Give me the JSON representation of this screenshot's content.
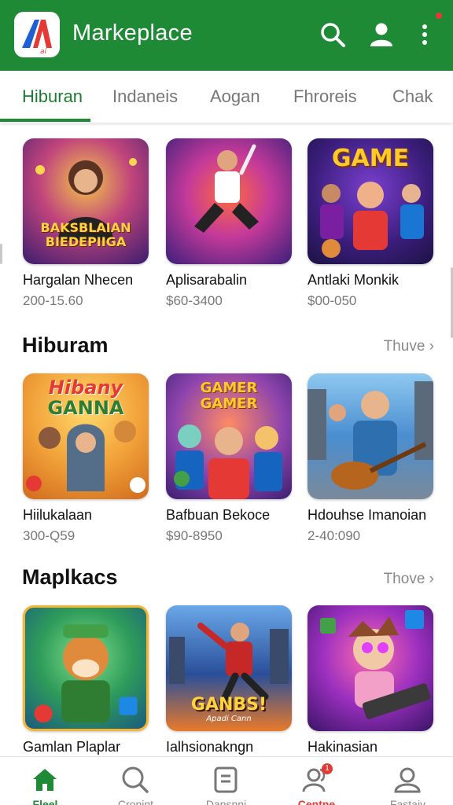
{
  "header": {
    "title": "Markeplace",
    "logo_text": "ai",
    "bg_color": "#1e8a35"
  },
  "tabs": [
    {
      "label": "Hiburan",
      "active": true
    },
    {
      "label": "Indaneis",
      "active": false
    },
    {
      "label": "Aogan",
      "active": false
    },
    {
      "label": "Fhroreis",
      "active": false
    },
    {
      "label": "Chak",
      "active": false
    }
  ],
  "row1": [
    {
      "title": "Hargalan Nhecen",
      "price": "200-15.60",
      "art_lines": [
        "BAKSBLAIAN",
        "BIEDEPIIGA"
      ]
    },
    {
      "title": "Aplisarabalin",
      "price": "$60-3400"
    },
    {
      "title": "Antlaki Monkik",
      "price": "$00-050",
      "art_lines": [
        "GAME"
      ]
    }
  ],
  "section1": {
    "title": "Hiburam",
    "see_more": "Thuve",
    "items": [
      {
        "title": "Hiilukalaan",
        "price": "300-Q59",
        "art_lines": [
          "Hibany",
          "GANNA"
        ]
      },
      {
        "title": "Bafbuan Bekoce",
        "price": "$90-8950",
        "art_lines": [
          "GAMER",
          "GAMER"
        ]
      },
      {
        "title": "Hdouhse Imanoian",
        "price": "2-40:090"
      }
    ]
  },
  "section2": {
    "title": "Maplkacs",
    "see_more": "Thove",
    "items": [
      {
        "title": "Gamlan Plaplar"
      },
      {
        "title": "Ialhsionakngn",
        "art_lines": [
          "GANBS!",
          "Apadi Cann"
        ]
      },
      {
        "title": "Hakinasian"
      }
    ]
  },
  "bottom_nav": [
    {
      "label": "Fleel",
      "icon": "home-icon",
      "active": true
    },
    {
      "label": "Cronint",
      "icon": "search-icon",
      "active": false
    },
    {
      "label": "Dansnni",
      "icon": "document-icon",
      "active": false
    },
    {
      "label": "Centne",
      "icon": "people-icon",
      "active": false,
      "badge": "1"
    },
    {
      "label": "Fastaiv",
      "icon": "profile-icon",
      "active": false
    }
  ]
}
